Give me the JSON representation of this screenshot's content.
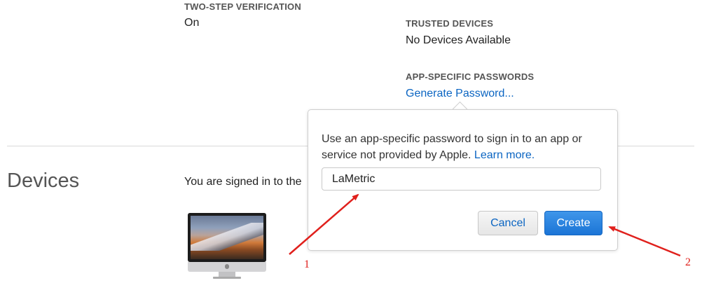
{
  "security": {
    "two_step_label": "TWO-STEP VERIFICATION",
    "two_step_value": "On",
    "trusted_label": "TRUSTED DEVICES",
    "trusted_value": "No Devices Available",
    "app_pw_label": "APP-SPECIFIC PASSWORDS",
    "generate_link": "Generate Password..."
  },
  "devices": {
    "title": "Devices",
    "signed_in_text": "You are signed in to the"
  },
  "popover": {
    "description": "Use an app-specific password to sign in to an app or service not provided by Apple.",
    "learn_more": "Learn more.",
    "input_value": "LaMetric",
    "cancel_label": "Cancel",
    "create_label": "Create"
  },
  "annotations": {
    "marker_1": "1",
    "marker_2": "2",
    "arrow_color": "#e0201c"
  },
  "colors": {
    "link": "#0b65c2",
    "primary_button": "#1b74d6"
  }
}
